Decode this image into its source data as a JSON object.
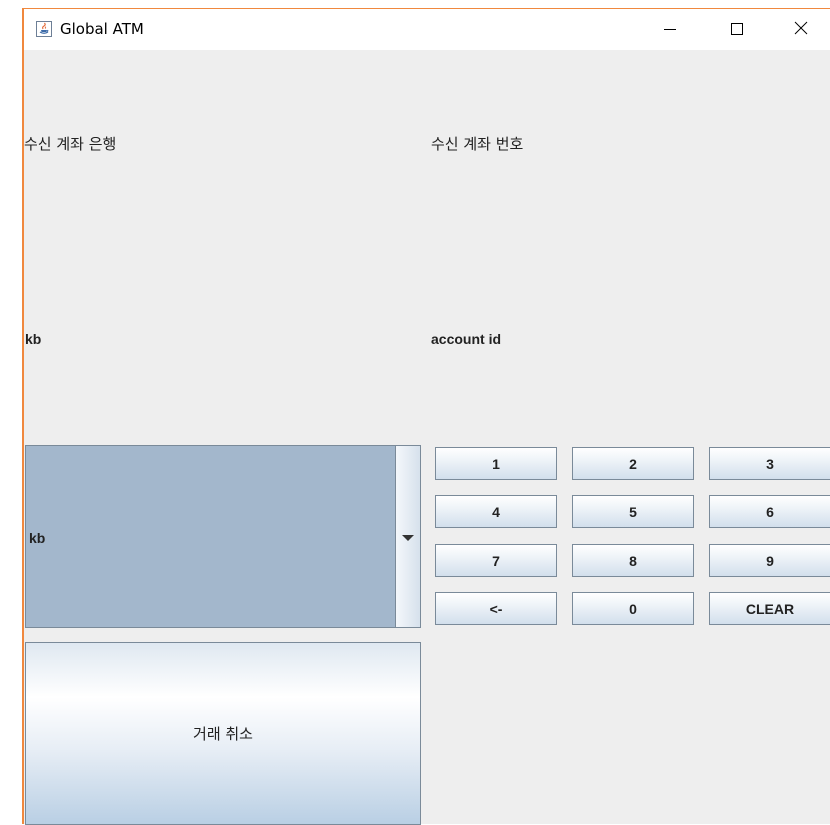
{
  "window": {
    "title": "Global ATM",
    "accent_border": "#f0883e"
  },
  "labels": {
    "receiving_bank_heading": "수신 계좌 은행",
    "receiving_account_heading": "수신 계좌 번호",
    "bank_value": "kb",
    "account_value": "account id"
  },
  "bank_select": {
    "selected": "kb"
  },
  "keypad": {
    "keys": [
      "1",
      "2",
      "3",
      "4",
      "5",
      "6",
      "7",
      "8",
      "9",
      "<-",
      "0",
      "CLEAR"
    ]
  },
  "cancel_button": {
    "label": "거래 취소"
  }
}
